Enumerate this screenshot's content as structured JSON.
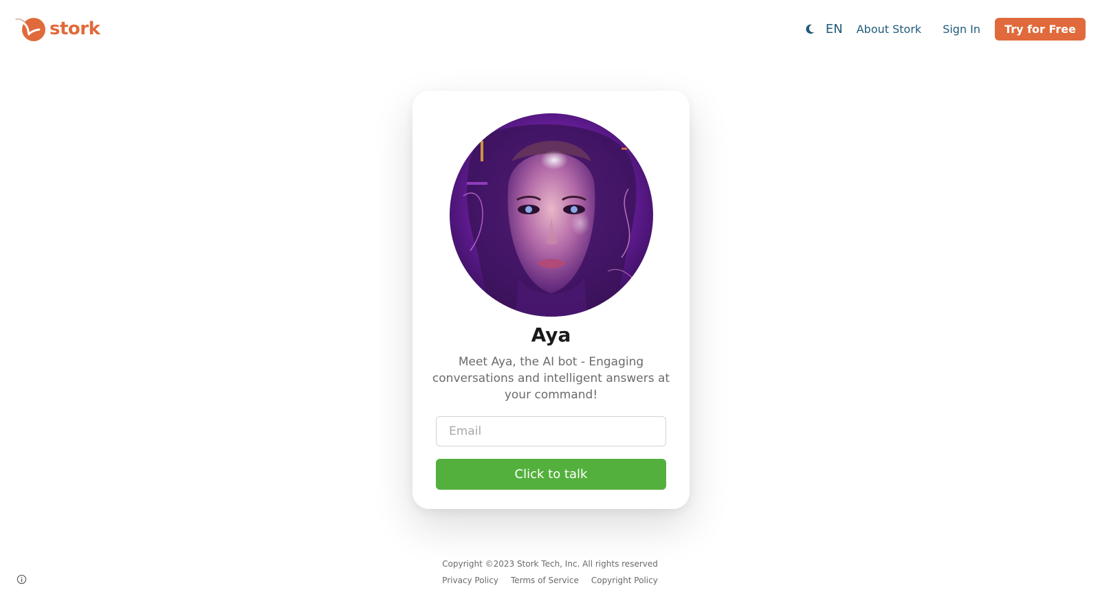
{
  "header": {
    "brand": "stork",
    "language": "EN",
    "about_label": "About Stork",
    "signin_label": "Sign In",
    "try_label": "Try for Free"
  },
  "card": {
    "bot_name": "Aya",
    "description": "Meet Aya, the AI bot - Engaging conversations and intelligent answers at your command!",
    "email_placeholder": "Email",
    "email_value": "",
    "button_label": "Click to talk"
  },
  "footer": {
    "copyright": "Copyright ©2023 Stork Tech, Inc. All rights reserved",
    "links": [
      "Privacy Policy",
      "Terms of Service",
      "Copyright Policy"
    ]
  },
  "icons": {
    "logo": "stork-bird-logo-icon",
    "theme_toggle": "moon-icon",
    "info": "info-icon"
  },
  "colors": {
    "brand": "#e06a3b",
    "nav_text": "#1e5a7a",
    "primary_button": "#53b03d",
    "muted_text": "#6a6a6a"
  }
}
